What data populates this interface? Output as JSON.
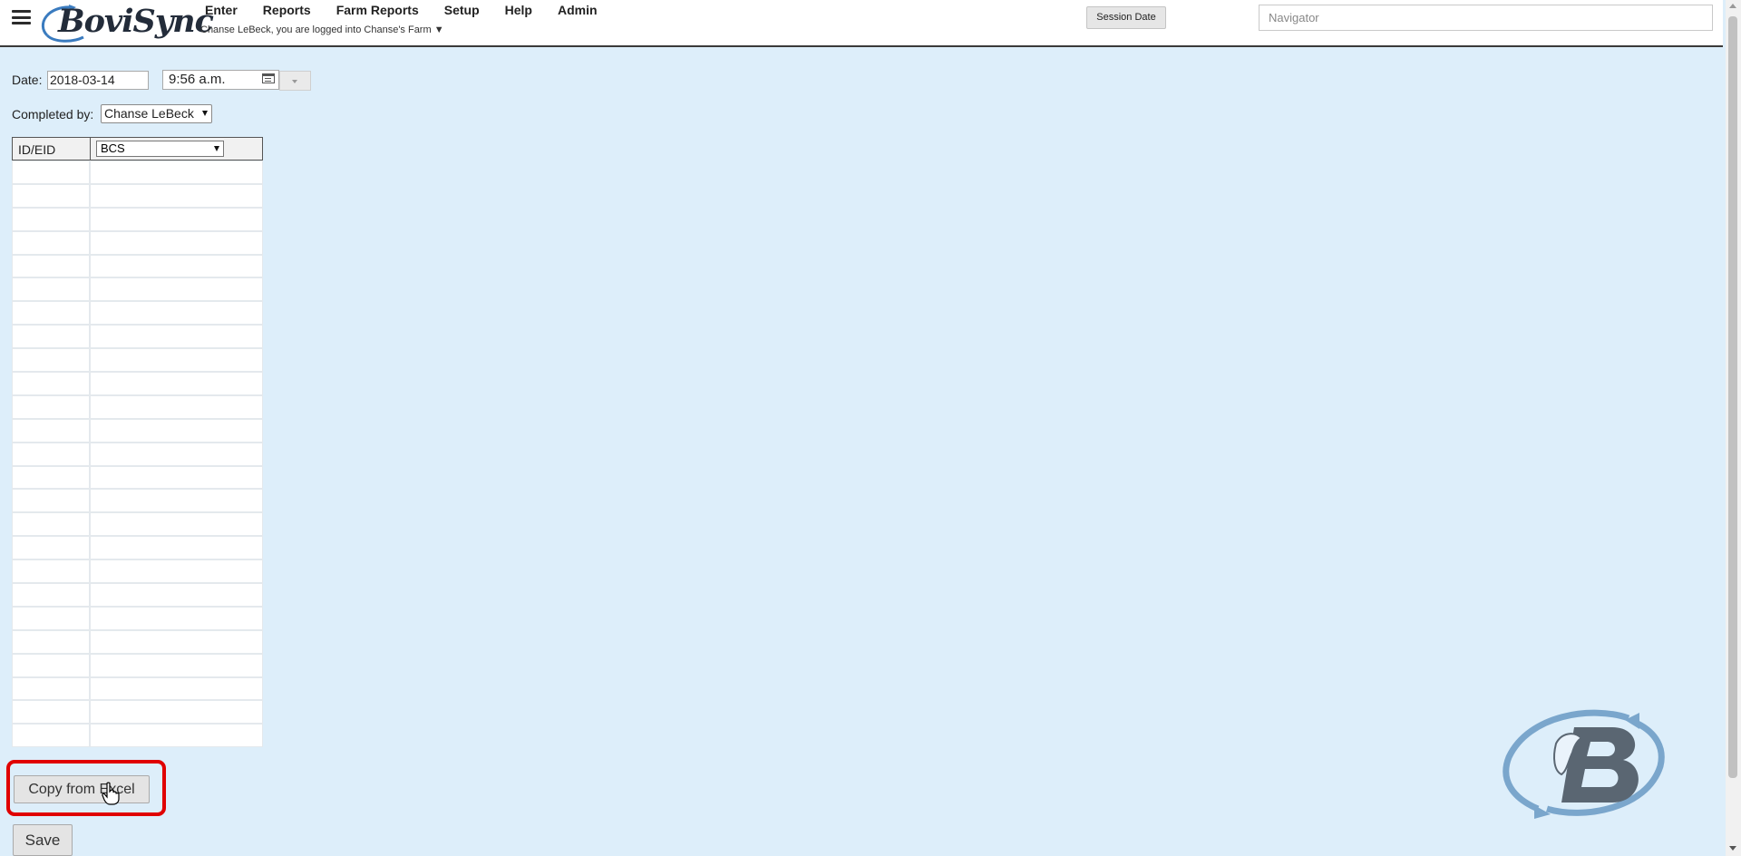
{
  "header": {
    "logo_text": "BoviSync",
    "menu": [
      {
        "label": "Enter"
      },
      {
        "label": "Reports"
      },
      {
        "label": "Farm Reports"
      },
      {
        "label": "Setup"
      },
      {
        "label": "Help"
      },
      {
        "label": "Admin"
      }
    ],
    "login_info": "Chanse LeBeck, you are logged into Chanse's Farm ▼",
    "session_date_label": "Session Date",
    "navigator_placeholder": "Navigator"
  },
  "form": {
    "date_label": "Date:",
    "date_value": "2018-03-14",
    "time_value": "9:56 a.m.",
    "completed_by_label": "Completed by:",
    "completed_by_value": "Chanse LeBeck"
  },
  "grid": {
    "id_header": "ID/EID",
    "value_header_selected": "BCS",
    "row_count": 25
  },
  "buttons": {
    "copy_from_excel": "Copy from Excel",
    "save": "Save"
  },
  "colors": {
    "page_background": "#ddeefa",
    "highlight": "#e00000",
    "watermark": "#7aa6cc"
  }
}
